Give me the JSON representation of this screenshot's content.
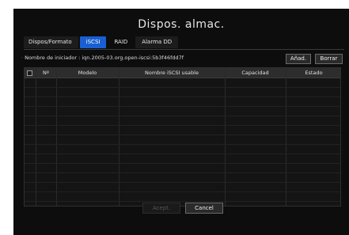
{
  "dialog": {
    "title": "Dispos. almac."
  },
  "tabs": [
    {
      "label": "Dispos/Formato",
      "active": false
    },
    {
      "label": "iSCSI",
      "active": true
    },
    {
      "label": "RAID",
      "active": false
    },
    {
      "label": "Alarma DD",
      "active": false
    }
  ],
  "initiator": {
    "label": "Nombre de iniciador : iqn.2005-03.org.open-iscsi:5b3f46fdd7f"
  },
  "buttons": {
    "add": "Añad.",
    "delete": "Borrar",
    "ok": "Acept.",
    "cancel": "Cancel"
  },
  "table": {
    "columns": [
      "",
      "Nº",
      "Modelo",
      "Nombre iSCSI usable",
      "Capacidad",
      "Estado"
    ],
    "rows": []
  },
  "colors": {
    "accent": "#1a5fd1",
    "background": "#0d0d0d",
    "header_row": "#2d2d2d"
  }
}
